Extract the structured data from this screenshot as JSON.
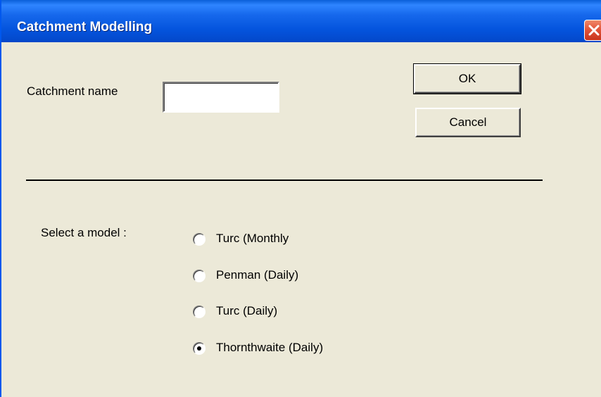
{
  "window": {
    "title": "Catchment Modelling"
  },
  "form": {
    "catchment_label": "Catchment name",
    "catchment_value": "",
    "model_label": "Select a model :"
  },
  "buttons": {
    "ok_label": "OK",
    "cancel_label": "Cancel"
  },
  "models": [
    {
      "label": "Turc (Monthly",
      "selected": false
    },
    {
      "label": "Penman (Daily)",
      "selected": false
    },
    {
      "label": "Turc (Daily)",
      "selected": false
    },
    {
      "label": "Thornthwaite (Daily)",
      "selected": true
    }
  ]
}
